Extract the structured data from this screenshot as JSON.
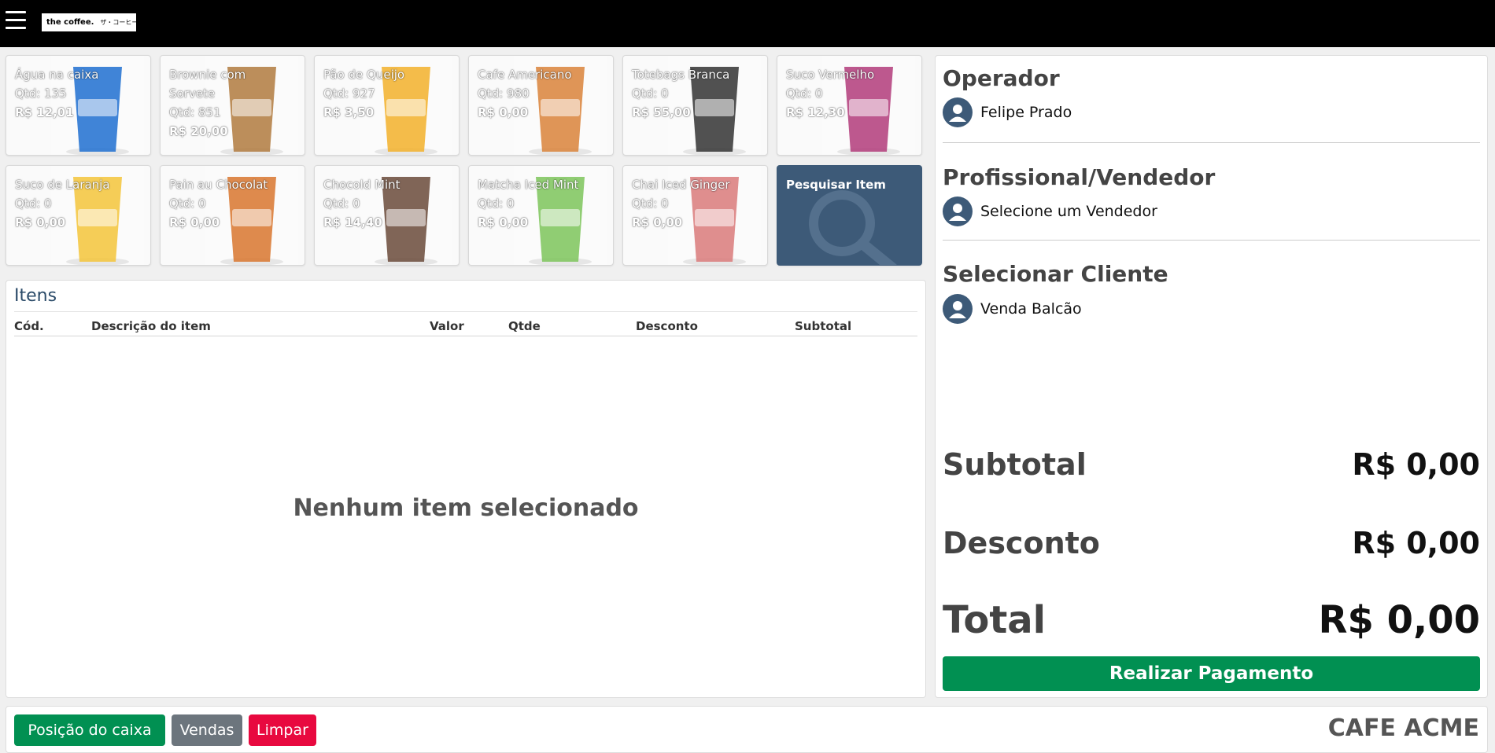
{
  "header": {
    "logo_text": "the coffee.",
    "logo_jp": "ザ・コーヒー"
  },
  "products": [
    {
      "name": "Água na caixa",
      "qty": "Qtd: 135",
      "price": "R$ 12,01",
      "art_color": "#1e6fd0"
    },
    {
      "name": "Brownie com Sorvete",
      "qty": "Qtd: 851",
      "price": "R$ 20,00",
      "art_color": "#b07a3e"
    },
    {
      "name": "Pão de Queijo",
      "qty": "Qtd: 927",
      "price": "R$ 3,50",
      "art_color": "#f2b02a"
    },
    {
      "name": "Cafe Americano",
      "qty": "Qtd: 980",
      "price": "R$ 0,00",
      "art_color": "#d9823a"
    },
    {
      "name": "Totebags Branca",
      "qty": "Qtd: 0",
      "price": "R$ 55,00",
      "art_color": "#333333"
    },
    {
      "name": "Suco Vermelho",
      "qty": "Qtd: 0",
      "price": "R$ 12,30",
      "art_color": "#b23b7a"
    },
    {
      "name": "Suco de Laranja",
      "qty": "Qtd: 0",
      "price": "R$ 0,00",
      "art_color": "#f3c43a"
    },
    {
      "name": "Pain au Chocolat",
      "qty": "Qtd: 0",
      "price": "R$ 0,00",
      "art_color": "#d8752e"
    },
    {
      "name": "Chocold Mint",
      "qty": "Qtd: 0",
      "price": "R$ 14,40",
      "art_color": "#6a4a3a"
    },
    {
      "name": "Matcha Iced Mint",
      "qty": "Qtd: 0",
      "price": "R$ 0,00",
      "art_color": "#7cc45a"
    },
    {
      "name": "Chai Iced Ginger",
      "qty": "Qtd: 0",
      "price": "R$ 0,00",
      "art_color": "#d97a7a"
    }
  ],
  "search_tile": {
    "label": "Pesquisar Item"
  },
  "items": {
    "title": "Itens",
    "columns": {
      "code": "Cód.",
      "description": "Descrição do item",
      "value": "Valor",
      "qty": "Qtde",
      "discount": "Desconto",
      "subtotal": "Subtotal"
    },
    "empty_message": "Nenhum item selecionado"
  },
  "right_panel": {
    "operator": {
      "title": "Operador",
      "value": "Felipe Prado"
    },
    "seller": {
      "title": "Profissional/Vendedor",
      "value": "Selecione um Vendedor"
    },
    "client": {
      "title": "Selecionar Cliente",
      "value": "Venda Balcão"
    },
    "subtotal": {
      "label": "Subtotal",
      "value": "R$ 0,00"
    },
    "discount": {
      "label": "Desconto",
      "value": "R$ 0,00"
    },
    "total": {
      "label": "Total",
      "value": "R$ 0,00"
    },
    "pay_button": "Realizar Pagamento"
  },
  "footer": {
    "cash_position_button": "Posição do caixa",
    "sales_button": "Vendas",
    "clear_button": "Limpar",
    "store_name": "CAFE ACME"
  },
  "colors": {
    "primary_green": "#019052",
    "danger_red": "#e8093f",
    "neutral_gray": "#6c757d",
    "accent_blue": "#3d5a78"
  }
}
